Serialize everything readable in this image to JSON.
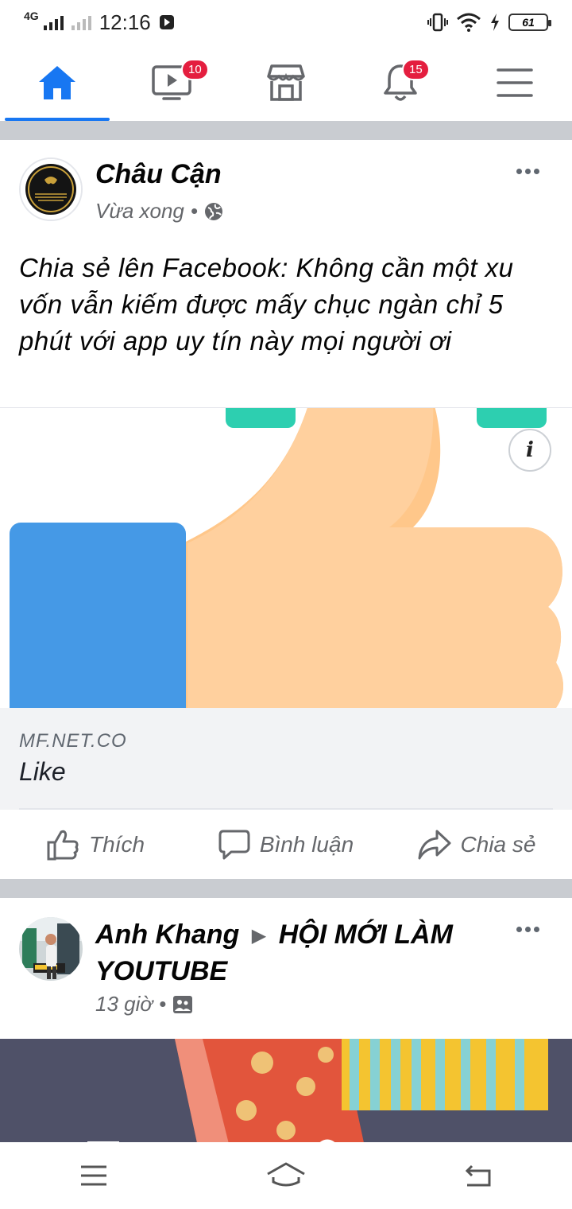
{
  "status": {
    "network": "4G",
    "time": "12:16",
    "battery": "61"
  },
  "nav": {
    "tabs": [
      {
        "name": "home",
        "badge": ""
      },
      {
        "name": "watch",
        "badge": "10"
      },
      {
        "name": "marketplace",
        "badge": ""
      },
      {
        "name": "notifications",
        "badge": "15"
      },
      {
        "name": "menu",
        "badge": ""
      }
    ]
  },
  "post1": {
    "author": "Châu Cận",
    "time": "Vừa xong",
    "privacy_icon": "globe-icon",
    "text": "Chia sẻ lên Facebook: Không cần một xu vốn vẫn kiếm được mấy chục ngàn chỉ 5 phút với app uy tín này mọi người ơi",
    "link_domain": "MF.NET.CO",
    "link_title": "Like",
    "actions": {
      "like": "Thích",
      "comment": "Bình luận",
      "share": "Chia sẻ"
    }
  },
  "post2": {
    "author": "Anh Khang",
    "group": "HỘI MỚI LÀM YOUTUBE",
    "time": "13 giờ",
    "privacy_icon": "group-icon"
  },
  "colors": {
    "accent": "#1877f2",
    "badge": "#e41e3f",
    "thumb": "#ffcc99",
    "cuff": "#4599e6",
    "teal": "#2dcfb0"
  }
}
